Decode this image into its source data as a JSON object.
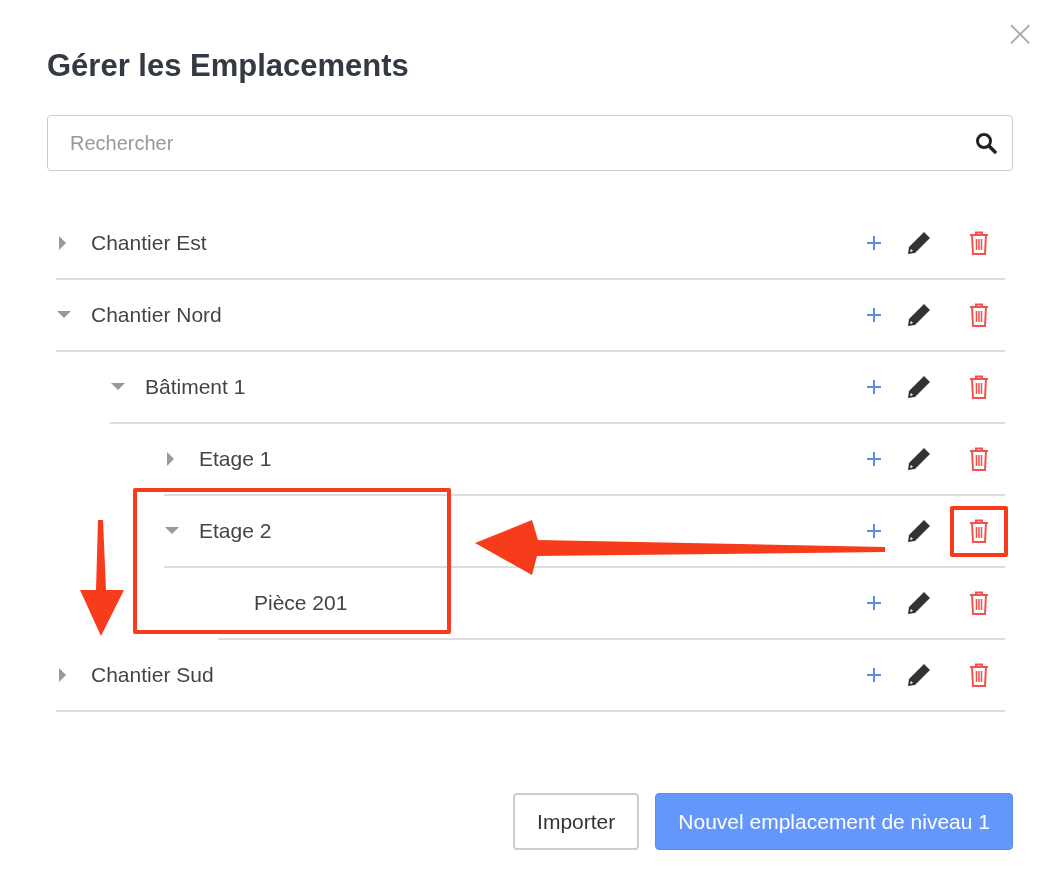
{
  "dialog": {
    "title": "Gérer les Emplacements",
    "close": "×"
  },
  "search": {
    "placeholder": "Rechercher"
  },
  "tree": [
    {
      "label": "Chantier Est",
      "expanded": false
    },
    {
      "label": "Chantier Nord",
      "expanded": true,
      "children": [
        {
          "label": "Bâtiment 1",
          "expanded": true,
          "children": [
            {
              "label": "Etage 1",
              "expanded": false
            },
            {
              "label": "Etage 2",
              "expanded": true,
              "highlighted": true,
              "delete_highlighted": true,
              "children": [
                {
                  "label": "Pièce 201",
                  "kind": "leaf"
                }
              ]
            }
          ]
        }
      ]
    },
    {
      "label": "Chantier Sud",
      "expanded": false
    }
  ],
  "buttons": [
    {
      "label": "Importer",
      "kind": "secondary"
    },
    {
      "label": "Nouvel emplacement de niveau 1",
      "kind": "primary"
    }
  ]
}
